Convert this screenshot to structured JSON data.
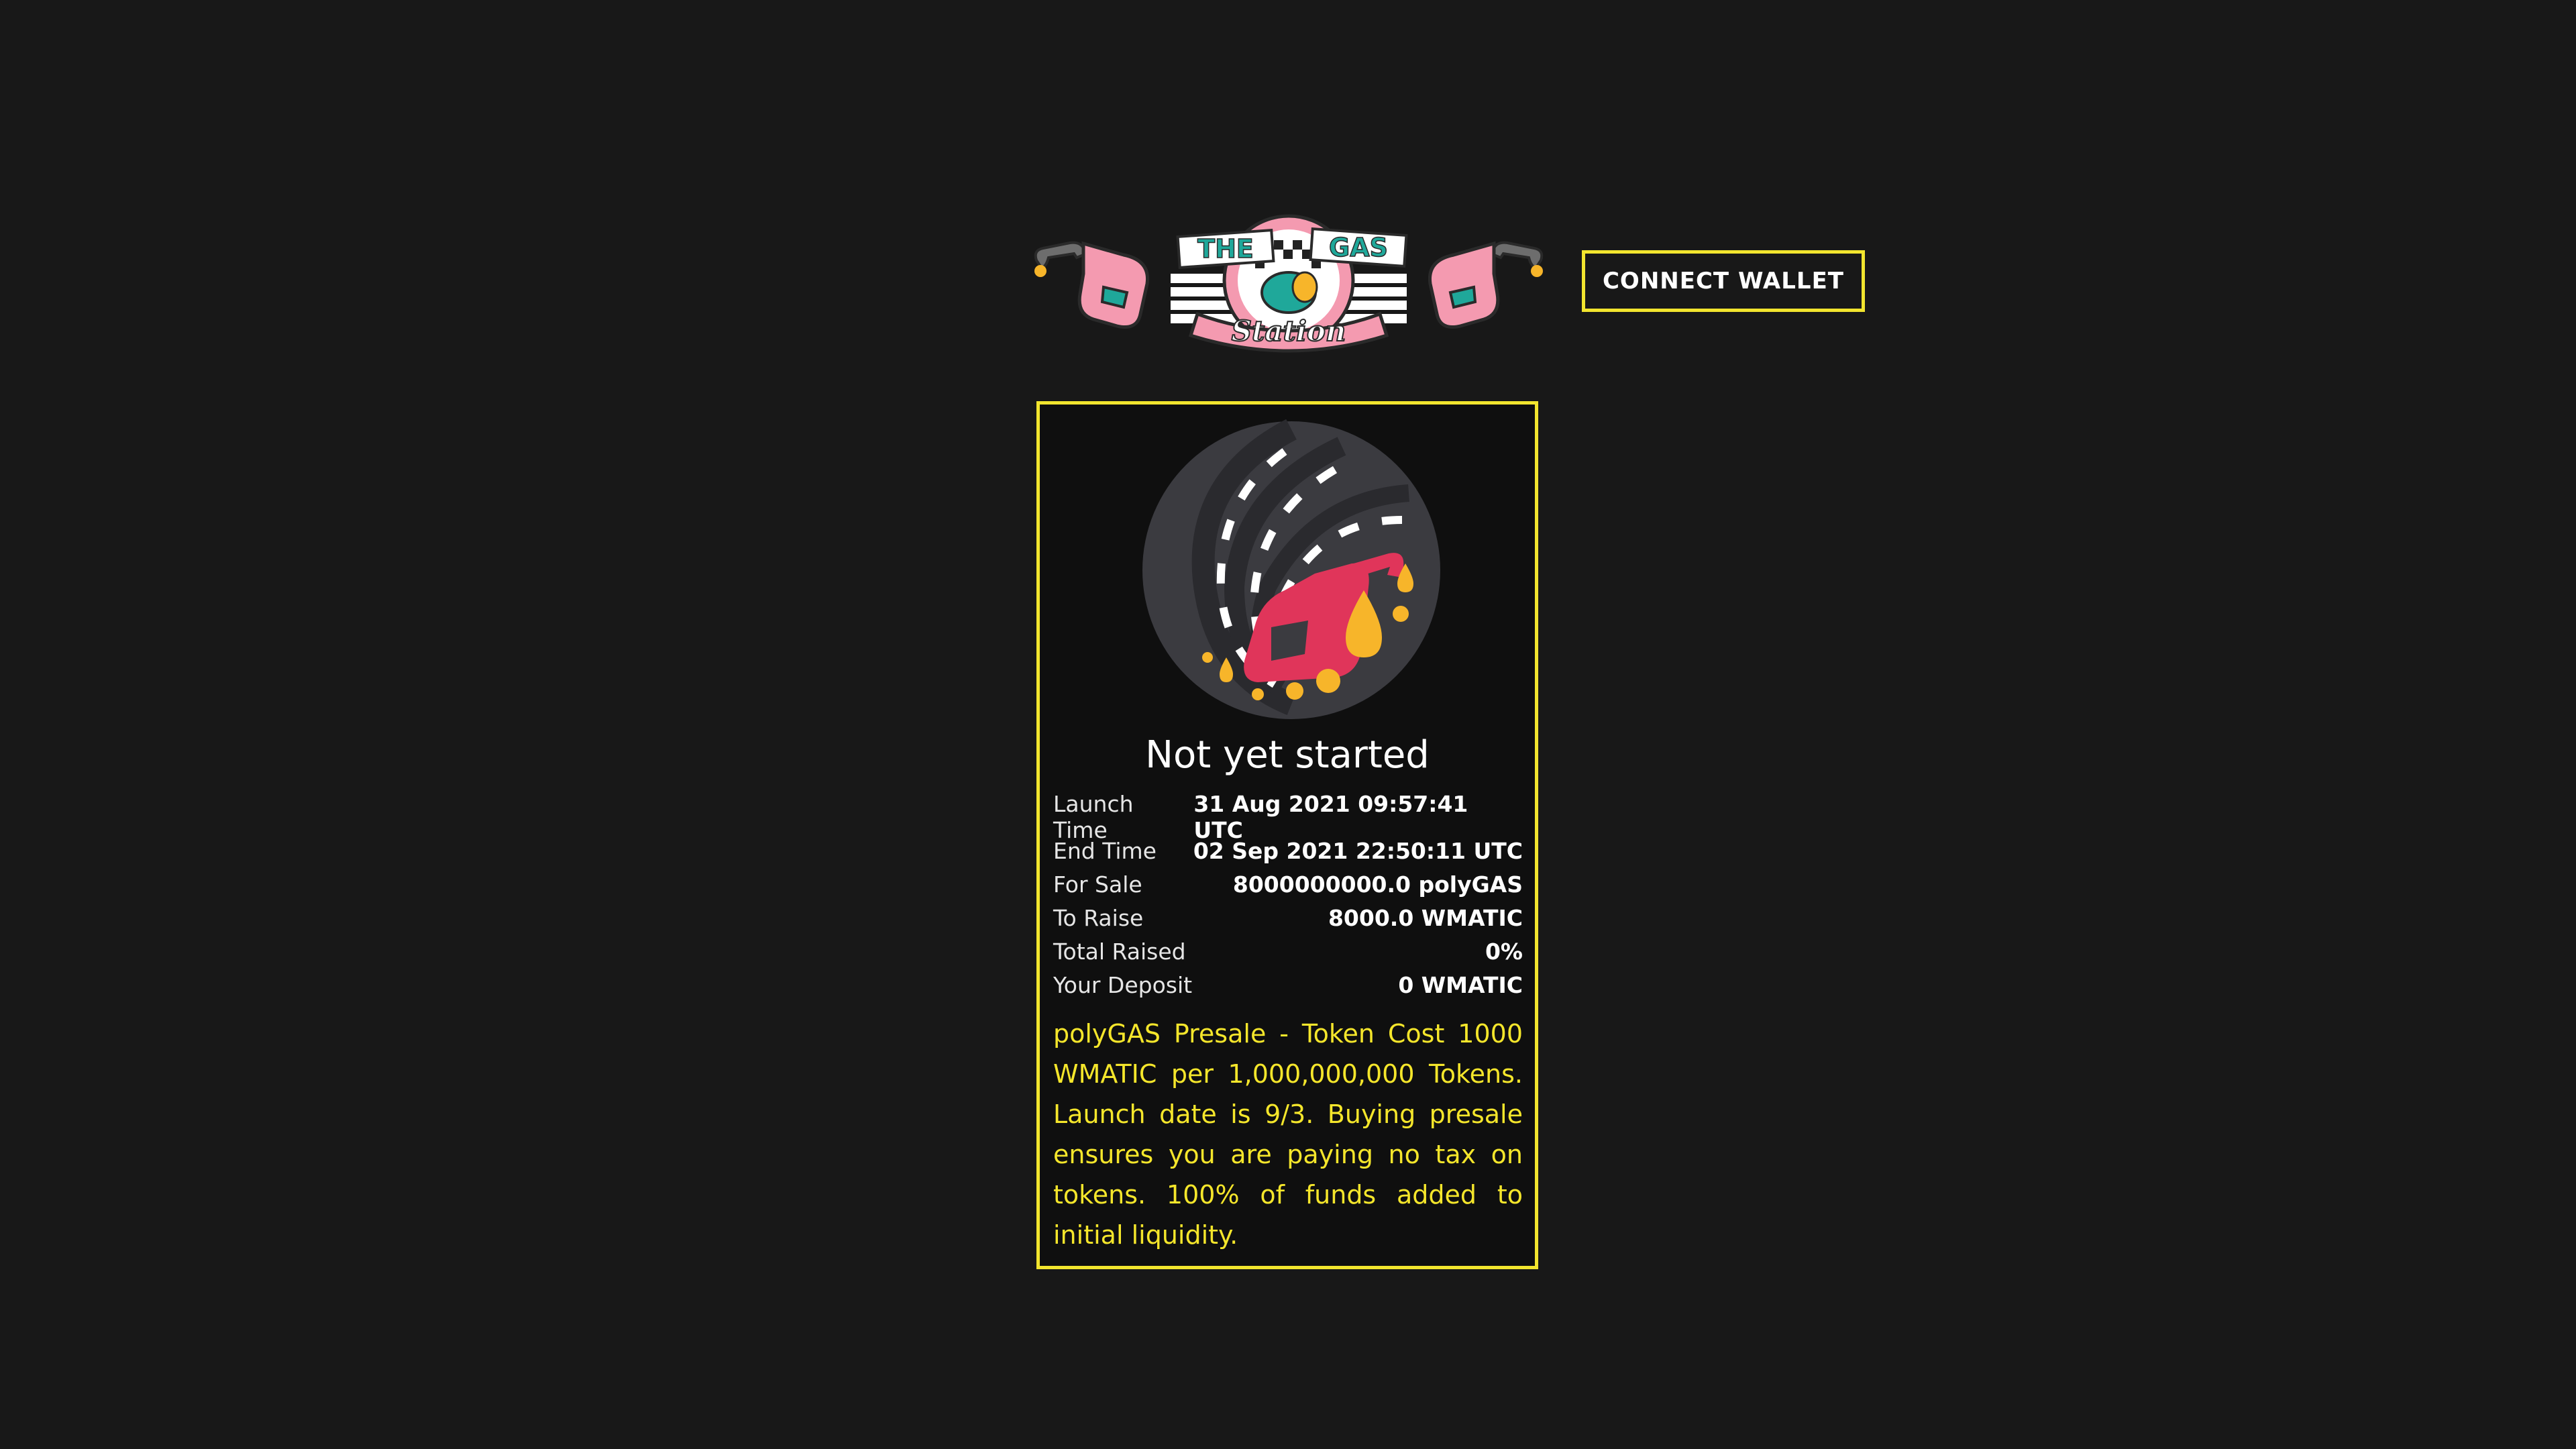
{
  "header": {
    "logo_text_top": "THE GAS",
    "logo_text_bottom": "Station",
    "connect_label": "CONNECT WALLET"
  },
  "presale": {
    "status": "Not yet started",
    "rows": [
      {
        "label": "Launch Time",
        "value": "31 Aug 2021 09:57:41 UTC"
      },
      {
        "label": "End Time",
        "value": "02 Sep 2021 22:50:11 UTC"
      },
      {
        "label": "For Sale",
        "value": "8000000000.0 polyGAS"
      },
      {
        "label": "To Raise",
        "value": "8000.0 WMATIC"
      },
      {
        "label": "Total Raised",
        "value": "0%"
      },
      {
        "label": "Your Deposit",
        "value": "0 WMATIC"
      }
    ],
    "description": "polyGAS Presale - Token Cost 1000 WMATIC per 1,000,000,000 Tokens. Launch date is 9/3. Buying presale ensures you are paying no tax on tokens. 100% of funds added to initial liquidity."
  },
  "colors": {
    "background": "#181818",
    "accent_yellow": "#f2e52e",
    "logo_pink": "#f49ab0",
    "logo_teal": "#1fa89a",
    "nozzle_red": "#e0355a",
    "drop_gold": "#f7b52a"
  }
}
